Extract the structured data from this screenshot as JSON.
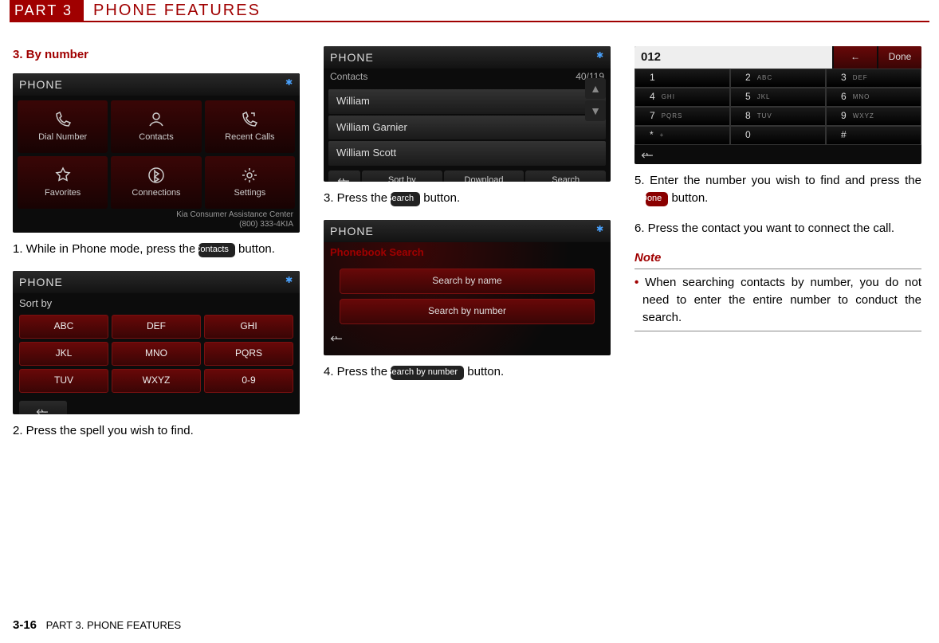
{
  "header": {
    "part": "PART 3",
    "title": "PHONE FEATURES"
  },
  "col1": {
    "heading": "3. By number",
    "step1_prefix": "1. While in Phone mode, press the ",
    "step1_button": "Contacts",
    "step1_suffix": " button.",
    "step2": "2. Press the spell you wish to find.",
    "ss1": {
      "title": "PHONE",
      "cells": [
        "Dial Number",
        "Contacts",
        "Recent Calls",
        "Favorites",
        "Connections",
        "Settings"
      ],
      "footer1": "Kia Consumer Assistance Center",
      "footer2": "(800) 333-4KIA"
    },
    "ss2": {
      "title": "PHONE",
      "subtitle": "Sort by",
      "rows": [
        [
          "ABC",
          "DEF",
          "GHI"
        ],
        [
          "JKL",
          "MNO",
          "PQRS"
        ],
        [
          "TUV",
          "WXYZ",
          "0-9"
        ]
      ]
    }
  },
  "col2": {
    "step3_prefix": "3. Press the ",
    "step3_button": "Search",
    "step3_suffix": " button.",
    "step4_prefix": "4. Press the ",
    "step4_button": "Search by number",
    "step4_suffix": "  button.",
    "ss3": {
      "title": "PHONE",
      "subtitle": "Contacts",
      "count": "40/119",
      "items": [
        "William",
        "William Garnier",
        "William Scott"
      ],
      "bottom": [
        "Sort by",
        "Download",
        "Search"
      ]
    },
    "ss4": {
      "title": "PHONE",
      "subtitle": "Phonebook Search",
      "opt1": "Search by name",
      "opt2": "Search by number"
    }
  },
  "col3": {
    "step5_prefix": "5. Enter the number you wish to find and press the ",
    "step5_button": "Done",
    "step5_suffix": " button.",
    "step6": "6. Press the contact you want to connect the call.",
    "note_label": "Note",
    "note_body": "When searching contacts by number, you do not need to enter the entire number to conduct the search.",
    "ss5": {
      "display": "012",
      "back": "←",
      "done": "Done",
      "keys": [
        {
          "n": "1",
          "s": ""
        },
        {
          "n": "2",
          "s": "ABC"
        },
        {
          "n": "3",
          "s": "DEF"
        },
        {
          "n": "4",
          "s": "GHI"
        },
        {
          "n": "5",
          "s": "JKL"
        },
        {
          "n": "6",
          "s": "MNO"
        },
        {
          "n": "7",
          "s": "PQRS"
        },
        {
          "n": "8",
          "s": "TUV"
        },
        {
          "n": "9",
          "s": "WXYZ"
        },
        {
          "n": "*",
          "s": "+"
        },
        {
          "n": "0",
          "s": ""
        },
        {
          "n": "#",
          "s": ""
        }
      ]
    }
  },
  "footer": {
    "page": "3-16",
    "text": "PART 3. PHONE FEATURES"
  }
}
